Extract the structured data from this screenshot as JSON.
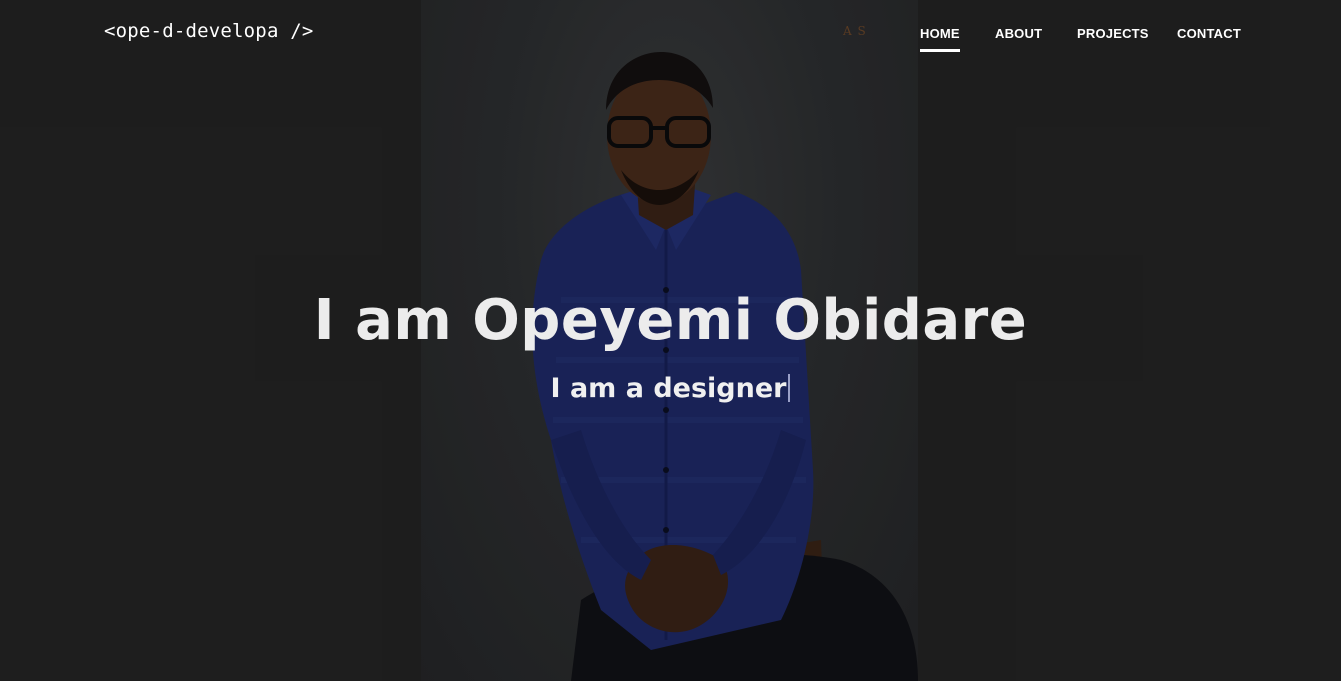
{
  "header": {
    "logo_text": "<ope-d-developa />",
    "brand_mark_text": "A S"
  },
  "nav": {
    "items": [
      {
        "label": "HOME",
        "active": true
      },
      {
        "label": "ABOUT",
        "active": false
      },
      {
        "label": "PROJECTS",
        "active": false
      },
      {
        "label": "CONTACT",
        "active": false
      }
    ]
  },
  "hero": {
    "title": "I am Opeyemi Obidare",
    "subtitle": "I am a designer",
    "photo_icon": "portrait-photo"
  },
  "colors": {
    "background": "#242424",
    "text": "#ffffff",
    "shirt": "#1f2a6a",
    "caret": "#9aa0c8"
  }
}
